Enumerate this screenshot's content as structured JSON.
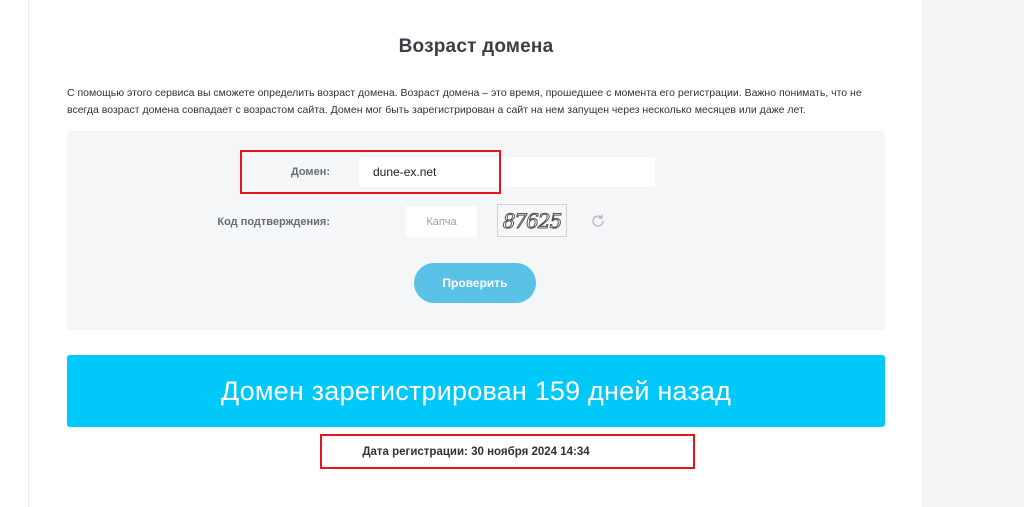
{
  "page": {
    "title": "Возраст домена",
    "description": "С помощью этого сервиса вы сможете определить возраст домена. Возраст домена – это время, прошедшее с момента его регистрации. Важно понимать, что не всегда возраст домена совпадает с возрастом сайта. Домен мог быть зарегистрирован а сайт на нем запущен через несколько месяцев или даже лет."
  },
  "form": {
    "domain_label": "Домен:",
    "domain_value": "dune-ex.net",
    "code_label": "Код подтверждения:",
    "captcha_placeholder": "Капча",
    "captcha_text": "87625",
    "submit_label": "Проверить"
  },
  "result": {
    "banner": "Домен зарегистрирован 159 дней назад",
    "reg_date": "Дата регистрации: 30 ноября 2024 14:34"
  },
  "colors": {
    "banner": "#00c8f8",
    "button": "#5bc2e7",
    "highlight": "#e8141b"
  }
}
